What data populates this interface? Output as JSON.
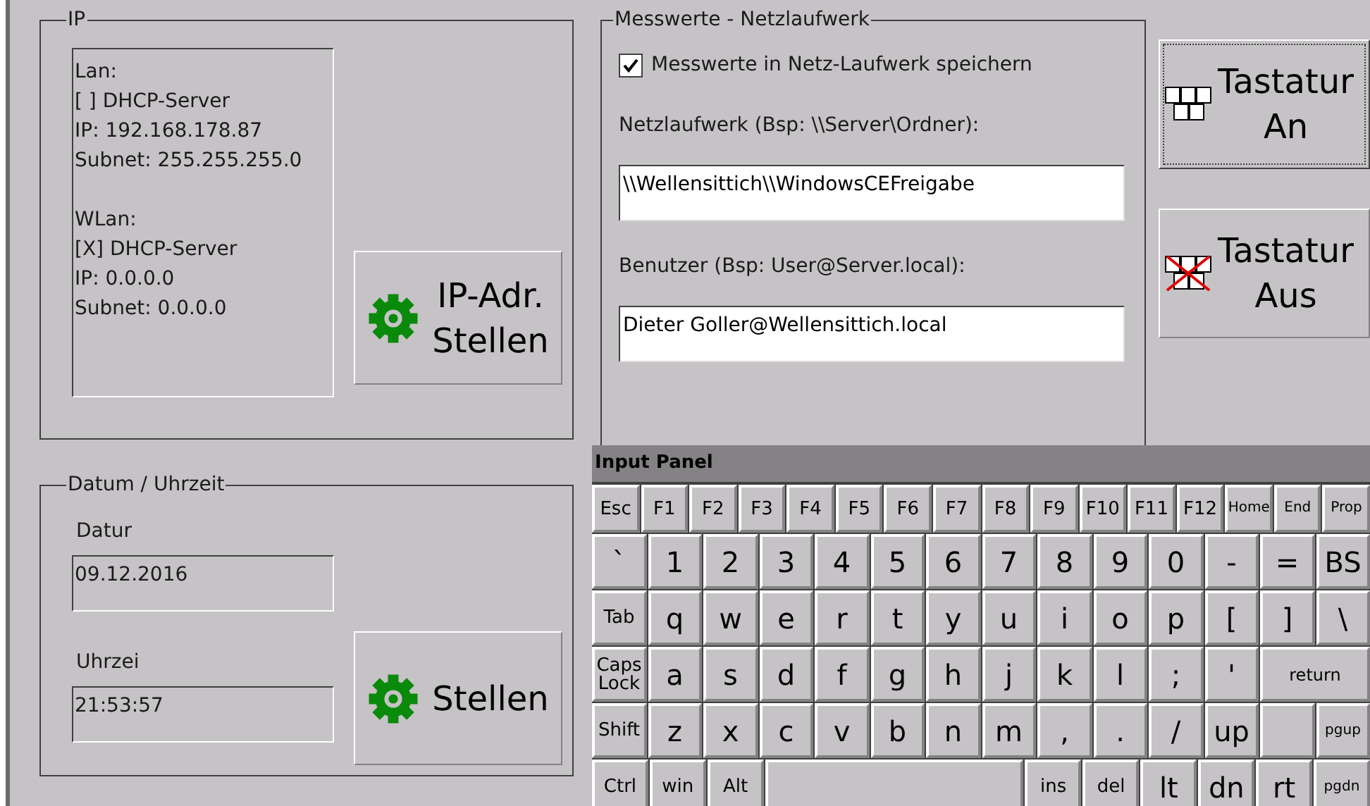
{
  "ip_group": {
    "title": "IP",
    "info_blocks": [
      {
        "lines": [
          "Lan:",
          "[ ] DHCP-Server",
          "IP: 192.168.178.87",
          "Subnet: 255.255.255.0"
        ]
      },
      {
        "lines": [
          "WLan:",
          "[X] DHCP-Server",
          "IP: 0.0.0.0",
          "Subnet: 0.0.0.0"
        ]
      }
    ],
    "button": [
      "IP-Adr.",
      "Stellen"
    ]
  },
  "datetime_group": {
    "title": "Datum / Uhrzeit",
    "fields": [
      {
        "label": "Datur",
        "value": "09.12.2016"
      },
      {
        "label": "Uhrzei",
        "value": "21:53:57"
      }
    ],
    "button": [
      "Stellen"
    ]
  },
  "network_group": {
    "title": "Messwerte - Netzlaufwerk",
    "save_checkbox": {
      "label": "Messwerte in Netz-Laufwerk speichern",
      "checked": true
    },
    "fields": [
      {
        "label": "Netzlaufwerk (Bsp: \\\\Server\\Ordner):",
        "value": "\\\\Wellensittich\\\\WindowsCEFreigabe"
      },
      {
        "label": "Benutzer (Bsp: User@Server.local):",
        "value": "Dieter Goller@Wellensittich.local"
      }
    ]
  },
  "keyboard_buttons": [
    {
      "lines": [
        "Tastatur",
        "An"
      ],
      "kind": "on",
      "focused": true
    },
    {
      "lines": [
        "Tastatur",
        "Aus"
      ],
      "kind": "off",
      "focused": false
    }
  ],
  "input_panel": {
    "title": "Input Panel",
    "function_keys": [
      {
        "label": "Esc",
        "kind": "control"
      },
      {
        "label": "F1",
        "kind": "control"
      },
      {
        "label": "F2",
        "kind": "control"
      },
      {
        "label": "F3",
        "kind": "control"
      },
      {
        "label": "F4",
        "kind": "control"
      },
      {
        "label": "F5",
        "kind": "control"
      },
      {
        "label": "F6",
        "kind": "control"
      },
      {
        "label": "F7",
        "kind": "control"
      },
      {
        "label": "F8",
        "kind": "control"
      },
      {
        "label": "F9",
        "kind": "control"
      },
      {
        "label": "F10",
        "kind": "control"
      },
      {
        "label": "F11",
        "kind": "control"
      },
      {
        "label": "F12",
        "kind": "control"
      },
      {
        "label": "Home",
        "kind": "tiny"
      },
      {
        "label": "End",
        "kind": "tiny"
      },
      {
        "label": "Prop",
        "kind": "tiny"
      }
    ],
    "rows": [
      [
        {
          "label": "`",
          "kind": "char"
        },
        {
          "label": "1",
          "kind": "char"
        },
        {
          "label": "2",
          "kind": "char"
        },
        {
          "label": "3",
          "kind": "char"
        },
        {
          "label": "4",
          "kind": "char"
        },
        {
          "label": "5",
          "kind": "char"
        },
        {
          "label": "6",
          "kind": "char"
        },
        {
          "label": "7",
          "kind": "char"
        },
        {
          "label": "8",
          "kind": "char"
        },
        {
          "label": "9",
          "kind": "char"
        },
        {
          "label": "0",
          "kind": "char"
        },
        {
          "label": "-",
          "kind": "char"
        },
        {
          "label": "=",
          "kind": "char"
        },
        {
          "label": "BS",
          "kind": "char"
        }
      ],
      [
        {
          "label": "Tab",
          "kind": "control"
        },
        {
          "label": "q",
          "kind": "char"
        },
        {
          "label": "w",
          "kind": "char"
        },
        {
          "label": "e",
          "kind": "char"
        },
        {
          "label": "r",
          "kind": "char"
        },
        {
          "label": "t",
          "kind": "char"
        },
        {
          "label": "y",
          "kind": "char"
        },
        {
          "label": "u",
          "kind": "char"
        },
        {
          "label": "i",
          "kind": "char"
        },
        {
          "label": "o",
          "kind": "char"
        },
        {
          "label": "p",
          "kind": "char"
        },
        {
          "label": "[",
          "kind": "char"
        },
        {
          "label": "]",
          "kind": "char"
        },
        {
          "label": "\\",
          "kind": "char"
        }
      ],
      [
        {
          "label": "Caps Lock",
          "kind": "control"
        },
        {
          "label": "a",
          "kind": "char"
        },
        {
          "label": "s",
          "kind": "char"
        },
        {
          "label": "d",
          "kind": "char"
        },
        {
          "label": "f",
          "kind": "char"
        },
        {
          "label": "g",
          "kind": "char"
        },
        {
          "label": "h",
          "kind": "char"
        },
        {
          "label": "j",
          "kind": "char"
        },
        {
          "label": "k",
          "kind": "char"
        },
        {
          "label": "l",
          "kind": "char"
        },
        {
          "label": ";",
          "kind": "char"
        },
        {
          "label": "'",
          "kind": "char"
        },
        {
          "label": "return",
          "kind": "wide"
        }
      ],
      [
        {
          "label": "Shift",
          "kind": "control"
        },
        {
          "label": "z",
          "kind": "char"
        },
        {
          "label": "x",
          "kind": "char"
        },
        {
          "label": "c",
          "kind": "char"
        },
        {
          "label": "v",
          "kind": "char"
        },
        {
          "label": "b",
          "kind": "char"
        },
        {
          "label": "n",
          "kind": "char"
        },
        {
          "label": "m",
          "kind": "char"
        },
        {
          "label": ",",
          "kind": "char"
        },
        {
          "label": ".",
          "kind": "char"
        },
        {
          "label": "/",
          "kind": "char"
        },
        {
          "label": "up",
          "kind": "char"
        },
        {
          "kind": "blank"
        },
        {
          "label": "pgup",
          "kind": "tiny"
        }
      ]
    ],
    "bottom_keys": [
      {
        "label": "Ctrl",
        "kind": "control"
      },
      {
        "label": "win",
        "kind": "control"
      },
      {
        "label": "Alt",
        "kind": "control"
      },
      {
        "kind": "space"
      },
      {
        "label": "ins",
        "kind": "control"
      },
      {
        "label": "del",
        "kind": "control"
      },
      {
        "label": "lt",
        "kind": "char"
      },
      {
        "label": "dn",
        "kind": "char"
      },
      {
        "label": "rt",
        "kind": "char"
      },
      {
        "label": "pgdn",
        "kind": "tiny"
      }
    ]
  }
}
